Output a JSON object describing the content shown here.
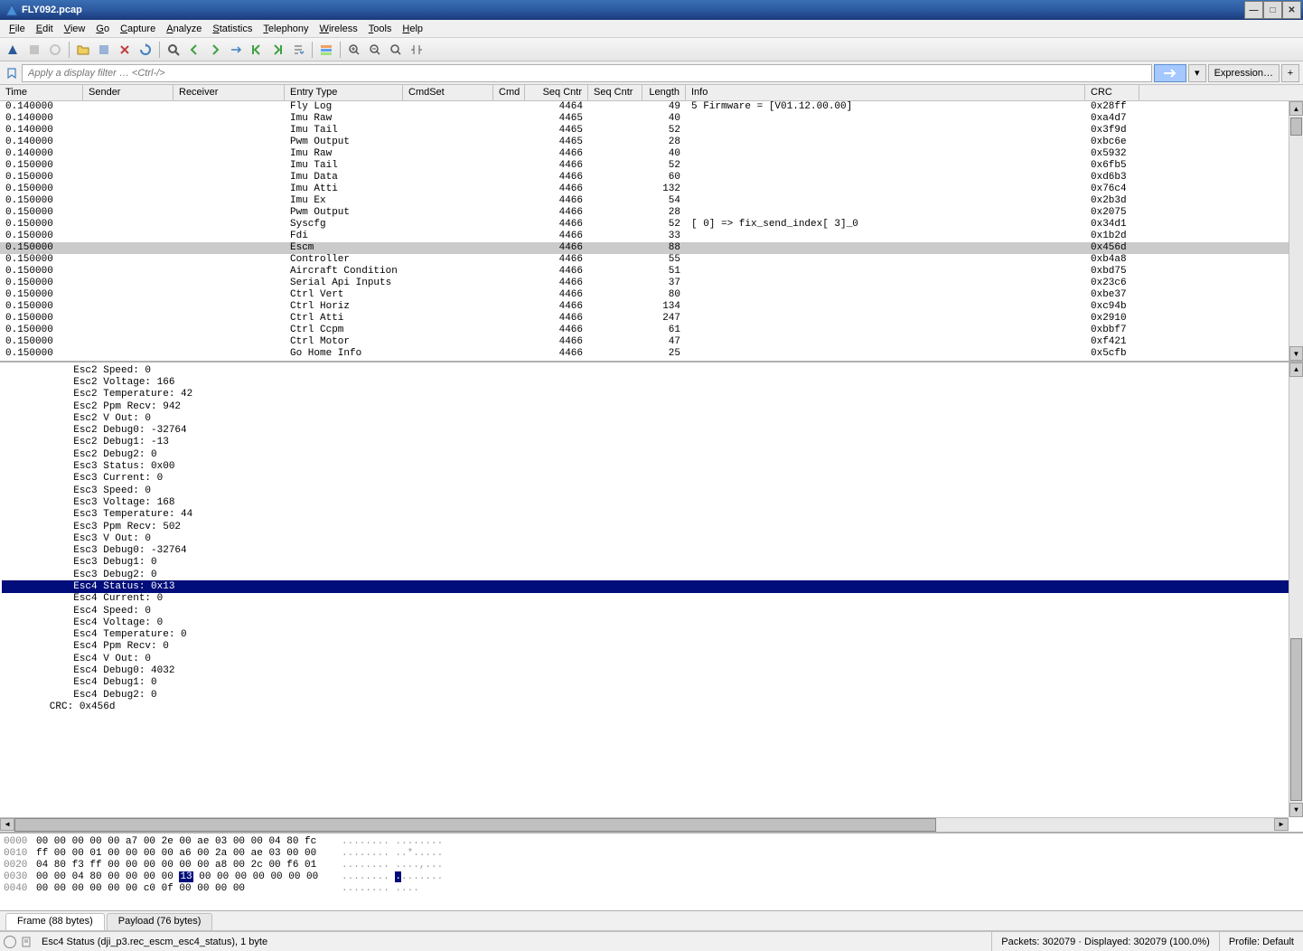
{
  "window": {
    "title": "FLY092.pcap"
  },
  "menu": {
    "items": [
      "File",
      "Edit",
      "View",
      "Go",
      "Capture",
      "Analyze",
      "Statistics",
      "Telephony",
      "Wireless",
      "Tools",
      "Help"
    ]
  },
  "filter": {
    "placeholder": "Apply a display filter … <Ctrl-/>",
    "expression_btn": "Expression…"
  },
  "packet_columns": [
    {
      "key": "time",
      "label": "Time",
      "cls": "col-time"
    },
    {
      "key": "sender",
      "label": "Sender",
      "cls": "col-sender"
    },
    {
      "key": "receiver",
      "label": "Receiver",
      "cls": "col-receiver"
    },
    {
      "key": "entry",
      "label": "Entry Type",
      "cls": "col-entry"
    },
    {
      "key": "cmdset",
      "label": "CmdSet",
      "cls": "col-cmdset"
    },
    {
      "key": "cmd",
      "label": "Cmd",
      "cls": "col-cmd"
    },
    {
      "key": "seq1",
      "label": "Seq Cntr",
      "cls": "col-seq1"
    },
    {
      "key": "seq2",
      "label": "Seq Cntr",
      "cls": "col-seq2"
    },
    {
      "key": "length",
      "label": "Length",
      "cls": "col-length"
    },
    {
      "key": "info",
      "label": "Info",
      "cls": "col-info"
    },
    {
      "key": "crc",
      "label": "CRC",
      "cls": "col-crc"
    }
  ],
  "packets": [
    {
      "time": "0.140000",
      "entry": "Fly Log",
      "seq1": "4464",
      "length": "49",
      "info": "       5 Firmware = [V01.12.00.00]",
      "crc": "0x28ff"
    },
    {
      "time": "0.140000",
      "entry": "Imu Raw",
      "seq1": "4465",
      "length": "40",
      "info": "",
      "crc": "0xa4d7"
    },
    {
      "time": "0.140000",
      "entry": "Imu Tail",
      "seq1": "4465",
      "length": "52",
      "info": "",
      "crc": "0x3f9d"
    },
    {
      "time": "0.140000",
      "entry": "Pwm Output",
      "seq1": "4465",
      "length": "28",
      "info": "",
      "crc": "0xbc6e"
    },
    {
      "time": "0.140000",
      "entry": "Imu Raw",
      "seq1": "4466",
      "length": "40",
      "info": "",
      "crc": "0x5932"
    },
    {
      "time": "0.150000",
      "entry": "Imu Tail",
      "seq1": "4466",
      "length": "52",
      "info": "",
      "crc": "0x6fb5"
    },
    {
      "time": "0.150000",
      "entry": "Imu Data",
      "seq1": "4466",
      "length": "60",
      "info": "",
      "crc": "0xd6b3"
    },
    {
      "time": "0.150000",
      "entry": "Imu Atti",
      "seq1": "4466",
      "length": "132",
      "info": "",
      "crc": "0x76c4"
    },
    {
      "time": "0.150000",
      "entry": "Imu Ex",
      "seq1": "4466",
      "length": "54",
      "info": "",
      "crc": "0x2b3d"
    },
    {
      "time": "0.150000",
      "entry": "Pwm Output",
      "seq1": "4466",
      "length": "28",
      "info": "",
      "crc": "0x2075"
    },
    {
      "time": "0.150000",
      "entry": "Syscfg",
      "seq1": "4466",
      "length": "52",
      "info": "[            0] => fix_send_index[ 3]_0",
      "crc": "0x34d1"
    },
    {
      "time": "0.150000",
      "entry": "Fdi",
      "seq1": "4466",
      "length": "33",
      "info": "",
      "crc": "0x1b2d"
    },
    {
      "time": "0.150000",
      "entry": "Escm",
      "seq1": "4466",
      "length": "88",
      "info": "",
      "crc": "0x456d",
      "sel": true
    },
    {
      "time": "0.150000",
      "entry": "Controller",
      "seq1": "4466",
      "length": "55",
      "info": "",
      "crc": "0xb4a8"
    },
    {
      "time": "0.150000",
      "entry": "Aircraft Condition …",
      "seq1": "4466",
      "length": "51",
      "info": "",
      "crc": "0xbd75"
    },
    {
      "time": "0.150000",
      "entry": "Serial Api Inputs",
      "seq1": "4466",
      "length": "37",
      "info": "",
      "crc": "0x23c6"
    },
    {
      "time": "0.150000",
      "entry": "Ctrl Vert",
      "seq1": "4466",
      "length": "80",
      "info": "",
      "crc": "0xbe37"
    },
    {
      "time": "0.150000",
      "entry": "Ctrl Horiz",
      "seq1": "4466",
      "length": "134",
      "info": "",
      "crc": "0xc94b"
    },
    {
      "time": "0.150000",
      "entry": "Ctrl Atti",
      "seq1": "4466",
      "length": "247",
      "info": "",
      "crc": "0x2910"
    },
    {
      "time": "0.150000",
      "entry": "Ctrl Ccpm",
      "seq1": "4466",
      "length": "61",
      "info": "",
      "crc": "0xbbf7"
    },
    {
      "time": "0.150000",
      "entry": "Ctrl Motor",
      "seq1": "4466",
      "length": "47",
      "info": "",
      "crc": "0xf421"
    },
    {
      "time": "0.150000",
      "entry": "Go Home Info",
      "seq1": "4466",
      "length": "25",
      "info": "",
      "crc": "0x5cfb"
    }
  ],
  "details": [
    {
      "indent": 3,
      "text": "Esc2 Speed: 0"
    },
    {
      "indent": 3,
      "text": "Esc2 Voltage: 166"
    },
    {
      "indent": 3,
      "text": "Esc2 Temperature: 42"
    },
    {
      "indent": 3,
      "text": "Esc2 Ppm Recv: 942"
    },
    {
      "indent": 3,
      "text": "Esc2 V Out: 0"
    },
    {
      "indent": 3,
      "text": "Esc2 Debug0: -32764"
    },
    {
      "indent": 3,
      "text": "Esc2 Debug1: -13"
    },
    {
      "indent": 3,
      "text": "Esc2 Debug2: 0"
    },
    {
      "indent": 3,
      "text": "Esc3 Status: 0x00"
    },
    {
      "indent": 3,
      "text": "Esc3 Current: 0"
    },
    {
      "indent": 3,
      "text": "Esc3 Speed: 0"
    },
    {
      "indent": 3,
      "text": "Esc3 Voltage: 168"
    },
    {
      "indent": 3,
      "text": "Esc3 Temperature: 44"
    },
    {
      "indent": 3,
      "text": "Esc3 Ppm Recv: 502"
    },
    {
      "indent": 3,
      "text": "Esc3 V Out: 0"
    },
    {
      "indent": 3,
      "text": "Esc3 Debug0: -32764"
    },
    {
      "indent": 3,
      "text": "Esc3 Debug1: 0"
    },
    {
      "indent": 3,
      "text": "Esc3 Debug2: 0"
    },
    {
      "indent": 3,
      "text": "Esc4 Status: 0x13",
      "sel": true
    },
    {
      "indent": 3,
      "text": "Esc4 Current: 0"
    },
    {
      "indent": 3,
      "text": "Esc4 Speed: 0"
    },
    {
      "indent": 3,
      "text": "Esc4 Voltage: 0"
    },
    {
      "indent": 3,
      "text": "Esc4 Temperature: 0"
    },
    {
      "indent": 3,
      "text": "Esc4 Ppm Recv: 0"
    },
    {
      "indent": 3,
      "text": "Esc4 V Out: 0"
    },
    {
      "indent": 3,
      "text": "Esc4 Debug0: 4032"
    },
    {
      "indent": 3,
      "text": "Esc4 Debug1: 0"
    },
    {
      "indent": 3,
      "text": "Esc4 Debug2: 0"
    },
    {
      "indent": 2,
      "text": "CRC: 0x456d"
    }
  ],
  "hex": {
    "rows": [
      {
        "offset": "0000",
        "bytes": "00 00 00 00 00 a7 00 2e  00 ae 03 00 00 04 80 fc",
        "ascii": "........ ........"
      },
      {
        "offset": "0010",
        "bytes": "ff 00 00 01 00 00 00 00  a6 00 2a 00 ae 03 00 00",
        "ascii": "........ ..*....."
      },
      {
        "offset": "0020",
        "bytes": "04 80 f3 ff 00 00 00 00  00 00 a8 00 2c 00 f6 01",
        "ascii": "........ ....,..."
      },
      {
        "offset": "0030",
        "bytes": "00 00 04 80 00 00 00 00  ",
        "bytes_hl": "13",
        "bytes_after": " 00 00 00 00 00 00 00",
        "ascii": "........ ",
        "ascii_hl": ".",
        "ascii_after": "......."
      },
      {
        "offset": "0040",
        "bytes": "00 00 00 00 00 00 c0 0f  00 00 00 00",
        "ascii": "........ ...."
      }
    ]
  },
  "tabs": [
    {
      "label": "Frame (88 bytes)",
      "active": true
    },
    {
      "label": "Payload (76 bytes)",
      "active": false
    }
  ],
  "status": {
    "field_info": "Esc4 Status (dji_p3.rec_escm_esc4_status), 1 byte",
    "packets": "Packets: 302079 · Displayed: 302079 (100.0%)",
    "profile": "Profile: Default"
  }
}
